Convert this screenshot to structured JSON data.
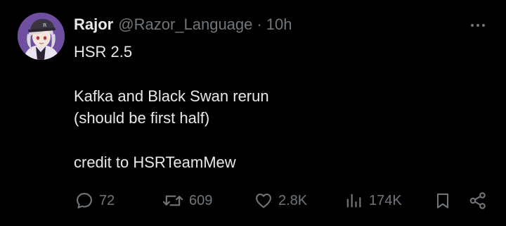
{
  "user": {
    "display_name": "Rajor",
    "handle": "@Razor_Language",
    "separator": "·",
    "time": "10h",
    "avatar_icon": "anime-avatar-icon"
  },
  "post": {
    "lines": [
      "HSR 2.5",
      "",
      "Kafka and Black Swan rerun",
      "(should be first half)",
      "",
      "credit to HSRTeamMew"
    ]
  },
  "actions": {
    "replies": "72",
    "reposts": "609",
    "likes": "2.8K",
    "views": "174K"
  },
  "icons": {
    "reply": "reply-icon",
    "repost": "repost-icon",
    "like": "heart-icon",
    "views": "views-icon",
    "bookmark": "bookmark-icon",
    "share": "share-icon",
    "more": "more-icon"
  },
  "colors": {
    "background": "#000000",
    "primary_text": "#e7e9ea",
    "secondary_text": "#71767b",
    "avatar_bg": "#6e4fa0"
  }
}
